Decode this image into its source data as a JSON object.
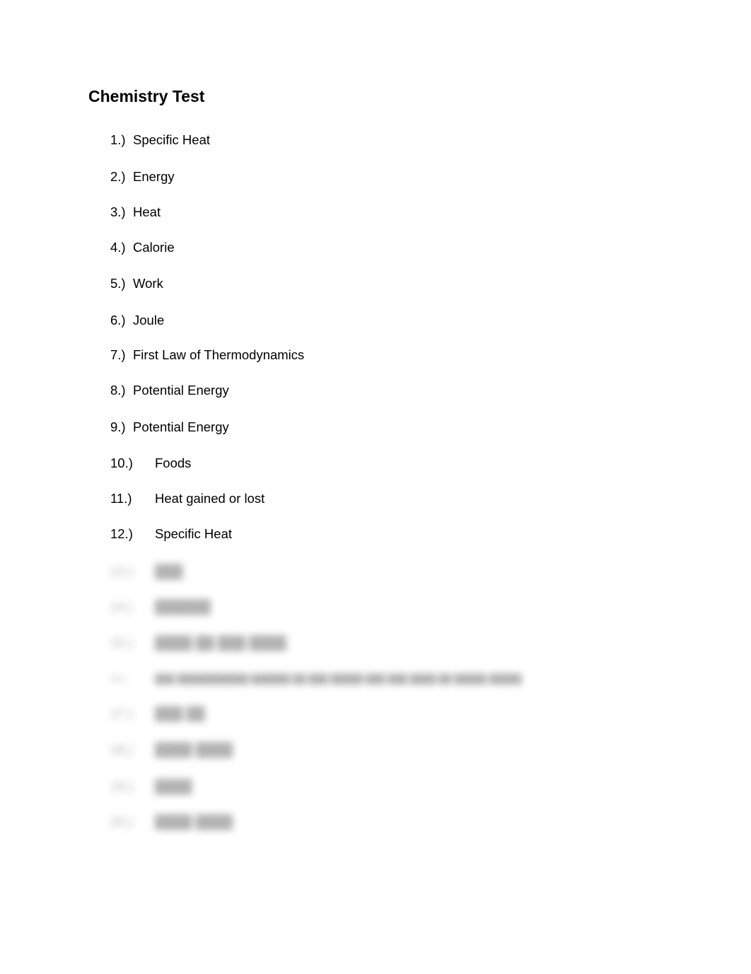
{
  "document": {
    "title": "Chemistry Test",
    "items": [
      {
        "num": "1.)",
        "text": "Specific Heat"
      },
      {
        "num": "2.)",
        "text": "Energy"
      },
      {
        "num": "3.)",
        "text": "Heat"
      },
      {
        "num": "4.)",
        "text": "Calorie"
      },
      {
        "num": "5.)",
        "text": "Work"
      },
      {
        "num": "6.)",
        "text": "Joule"
      },
      {
        "num": "7.)",
        "text": "First Law of Thermodynamics"
      },
      {
        "num": "8.)",
        "text": "Potential Energy"
      },
      {
        "num": "9.)",
        "text": "Potential Energy"
      },
      {
        "num": "10.)",
        "text": "Foods"
      },
      {
        "num": "11.)",
        "text": "Heat gained or lost"
      },
      {
        "num": "12.)",
        "text": "Specific Heat"
      }
    ],
    "blurred_items": [
      {
        "num": "13.)",
        "text": "███"
      },
      {
        "num": "14.)",
        "text": "██████"
      },
      {
        "num": "15.)",
        "text": "████ ██ ███ ████"
      },
      {
        "num": "16.)",
        "text": "███ ███████████ ██████ ██ ███ █████ ███ ███ ████ ██ █████ █████"
      },
      {
        "num": "17.)",
        "text": "███ ██"
      },
      {
        "num": "18.)",
        "text": "████ ████"
      },
      {
        "num": "19.)",
        "text": "████"
      },
      {
        "num": "20.)",
        "text": "████ ████"
      }
    ]
  }
}
